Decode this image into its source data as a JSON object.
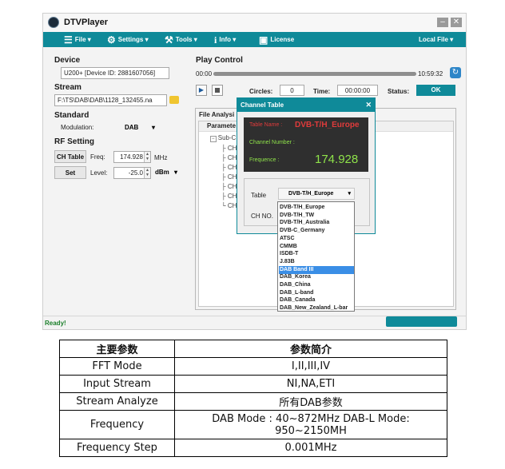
{
  "app": {
    "title": "DTVPlayer"
  },
  "window_controls": {
    "minimize": "–",
    "close": "✕"
  },
  "menu": {
    "items": [
      {
        "label": "File",
        "icon": "list-icon",
        "caret": "▾"
      },
      {
        "label": "Settings",
        "icon": "gear-icon",
        "caret": "▾"
      },
      {
        "label": "Tools",
        "icon": "tools-icon",
        "caret": "▾"
      },
      {
        "label": "Info",
        "icon": "info-icon",
        "caret": "▾"
      },
      {
        "label": "License",
        "icon": "license-icon",
        "caret": ""
      }
    ],
    "right": {
      "label": "Local File",
      "caret": "▾"
    }
  },
  "device": {
    "label": "Device",
    "value": "U200+ [Device ID: 2881607056]"
  },
  "stream": {
    "label": "Stream",
    "value": "F:\\TS\\DAB\\DAB\\1128_132455.na"
  },
  "standard": {
    "label": "Standard",
    "modulation_label": "Modulation:",
    "modulation_value": "DAB",
    "caret": "▾"
  },
  "rf": {
    "label": "RF Setting",
    "ch_table_button": "CH Table",
    "freq_label": "Freq:",
    "freq_value": "174.928",
    "freq_unit": "MHz",
    "set_button": "Set",
    "level_label": "Level:",
    "level_value": "-25.0",
    "level_unit": "dBm",
    "level_caret": "▾"
  },
  "play": {
    "label": "Play Control",
    "time_start": "00:00",
    "time_end": "10:59:32",
    "progress": 0.0,
    "circles_label": "Circles:",
    "circles_value": "0",
    "time_label": "Time:",
    "time_value": "00:00:00",
    "status_label": "Status:",
    "status_value": "OK"
  },
  "analysis": {
    "title": "File Analysi",
    "param_header": "Paramete",
    "tree_root": "Sub-C",
    "tree_children": [
      "CH",
      "CH",
      "CH",
      "CH",
      "CH",
      "CH",
      "CH"
    ]
  },
  "status_bar": {
    "text": "Ready!"
  },
  "dialog": {
    "title": "Channel Table",
    "close": "✕",
    "table_name_label": "Table Name :",
    "table_name_value": "DVB-T/H_Europe",
    "channel_number_label": "Channel Number :",
    "frequence_label": "Frequence :",
    "frequence_value": "174.928",
    "table_label": "Table",
    "table_value": "DVB-T/H_Europe",
    "table_caret": "▾",
    "ch_no_label": "CH NO."
  },
  "dropdown": {
    "options": [
      "DVB-T/H_Europe",
      "DVB-T/H_TW",
      "DVB-T/H_Australia",
      "DVB-C_Germany",
      "ATSC",
      "CMMB",
      "ISDB-T",
      "J.83B",
      "DAB Band III",
      "DAB_Korea",
      "DAB_China",
      "DAB_L-band",
      "DAB_Canada",
      "DAB_New_Zealand_L-bar"
    ],
    "selected_index": 8
  },
  "colors": {
    "accent": "#0f8a99",
    "dialog_dark": "#2f2f2f",
    "red_text": "#e03b3b",
    "green_text": "#8fe34a",
    "selected": "#3a8ee6"
  },
  "spec_table": {
    "headers": [
      "主要参数",
      "参数简介"
    ],
    "rows": [
      [
        "FFT Mode",
        "I,II,III,IV"
      ],
      [
        "Input Stream",
        "NI,NA,ETI"
      ],
      [
        "Stream Analyze",
        "所有DAB参数"
      ],
      [
        "Frequency",
        "DAB Mode : 40~872MHz    DAB-L Mode: 950~2150MH"
      ],
      [
        "Frequency Step",
        "0.001MHz"
      ]
    ]
  }
}
